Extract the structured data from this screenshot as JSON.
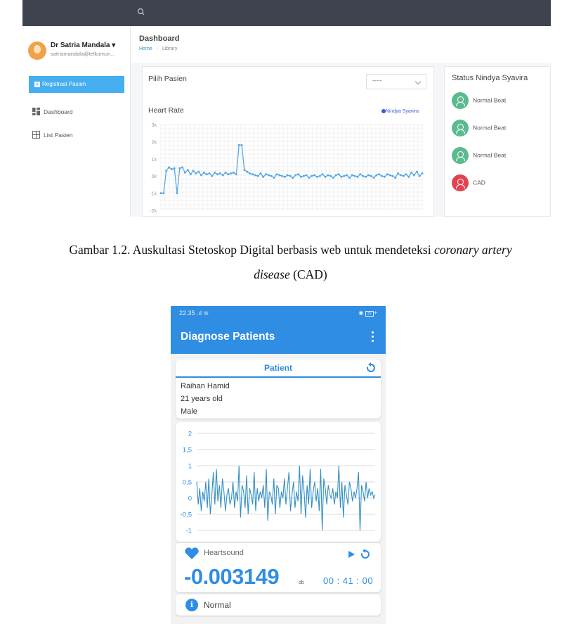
{
  "web": {
    "user_name": "Dr Satria Mandala",
    "user_email": "satriamandala@telkomun...",
    "register_button": "Registrasi Pasien",
    "nav": [
      {
        "label": "Dashboard",
        "icon": "dashboard-icon"
      },
      {
        "label": "List Pasien",
        "icon": "grid-icon"
      }
    ],
    "page_title": "Dashboard",
    "breadcrumb": {
      "home": "Home",
      "current": "Library"
    },
    "select_patient_label": "Pilih Pasien",
    "select_value": "-----",
    "heart_rate_title": "Heart Rate",
    "legend_label": "Nindya Syavira",
    "status_title": "Status Nindya Syavira",
    "status_items": [
      {
        "label": "Normal Beat",
        "color": "#5cba8f"
      },
      {
        "label": "Normal Beat",
        "color": "#5cba8f"
      },
      {
        "label": "Normal Beat",
        "color": "#5cba8f"
      },
      {
        "label": "CAD",
        "color": "#e24350"
      }
    ],
    "chart_data": {
      "type": "line",
      "title": "Heart Rate",
      "series_name": "Nindya Syavira",
      "y_ticks": [
        "3k",
        "2k",
        "1k",
        "0k",
        "-1k",
        "-2k"
      ],
      "ylim": [
        -2000,
        3000
      ],
      "grid": true,
      "legend": "top-right",
      "values": [
        -1000,
        -1000,
        300,
        500,
        400,
        450,
        -1000,
        450,
        500,
        200,
        350,
        100,
        300,
        150,
        250,
        50,
        200,
        100,
        150,
        0,
        200,
        100,
        150,
        50,
        200,
        100,
        150,
        200,
        100,
        1800,
        1800,
        350,
        250,
        150,
        100,
        50,
        0,
        150,
        -50,
        100,
        50,
        0,
        -100,
        100,
        50,
        0,
        -50,
        50,
        0,
        -100,
        50,
        100,
        -50,
        0,
        50,
        -100,
        0,
        50,
        -50,
        0,
        100,
        -50,
        50,
        0,
        -100,
        50,
        100,
        -50,
        0,
        50,
        -100,
        50,
        0,
        -50,
        100,
        0,
        -50,
        50,
        0,
        -100,
        50,
        100,
        0,
        -50,
        100,
        50,
        0,
        -100,
        150,
        50,
        0,
        100,
        -50,
        200,
        50,
        250,
        0,
        150
      ]
    }
  },
  "caption": {
    "line1_prefix": "Gambar 1.2. Auskultasi Stetoskop Digital berbasis web untuk mendeteksi ",
    "line1_italic": "coronary artery",
    "line2_italic": "disease",
    "line2_suffix": " (CAD)"
  },
  "phone": {
    "time": "22.35",
    "battery": "37",
    "app_title": "Diagnose Patients",
    "patient_header": "Patient",
    "patient_name": "Raihan Hamid",
    "patient_age": "21 years old",
    "patient_gender": "Male",
    "heartsound_label": "Heartsound",
    "value": "-0.003149",
    "unit": "db",
    "timer": "00 : 41 : 00",
    "status": "Normal",
    "accent_color": "#2f8de4",
    "chart_data": {
      "type": "line",
      "y_ticks": [
        "2",
        "1,5",
        "1",
        "0,5",
        "0",
        "-0,5",
        "-1"
      ],
      "ylim": [
        -1,
        2
      ],
      "grid": true,
      "values": [
        0.5,
        -0.2,
        0.3,
        -0.4,
        0.2,
        -0.1,
        0.5,
        -0.3,
        0.6,
        -0.5,
        0.1,
        0.8,
        -0.2,
        0.9,
        -0.1,
        0.4,
        -0.3,
        0.6,
        0.2,
        -0.4,
        0.1,
        0.3,
        -0.2,
        0.0,
        0.5,
        -0.3,
        0.2,
        -0.1,
        1.0,
        -0.6,
        0.4,
        0.2,
        -0.3,
        0.7,
        -0.5,
        0.3,
        0.1,
        -0.2,
        0.8,
        -0.4,
        0.3,
        -0.1,
        0.2,
        0.0,
        0.4,
        -0.3,
        0.9,
        -0.7,
        0.2,
        0.1,
        -0.2,
        0.6,
        -0.5,
        0.4,
        0.3,
        -0.3,
        0.2,
        0.0,
        0.6,
        -0.2,
        0.3,
        0.8,
        -0.4,
        0.1,
        0.5,
        -0.3,
        0.2,
        -0.1,
        1.0,
        -0.5,
        0.7,
        0.2,
        -0.6,
        0.4,
        -0.2,
        0.9,
        -0.3,
        0.2,
        0.5,
        -0.1,
        0.3,
        -0.4,
        0.9,
        -1.0,
        0.6,
        0.3,
        -0.2,
        0.4,
        0.1,
        0.0,
        0.3,
        -0.2,
        0.2,
        0.0,
        1.0,
        -0.3,
        0.5,
        -0.6,
        0.4,
        0.1,
        -0.2,
        0.5,
        0.3,
        -0.1,
        0.2,
        0.0,
        0.3,
        0.8,
        -1.0,
        0.4,
        0.2,
        -0.1,
        0.5,
        0.0,
        0.3,
        0.1,
        0.2,
        0.0,
        0.1
      ]
    }
  }
}
